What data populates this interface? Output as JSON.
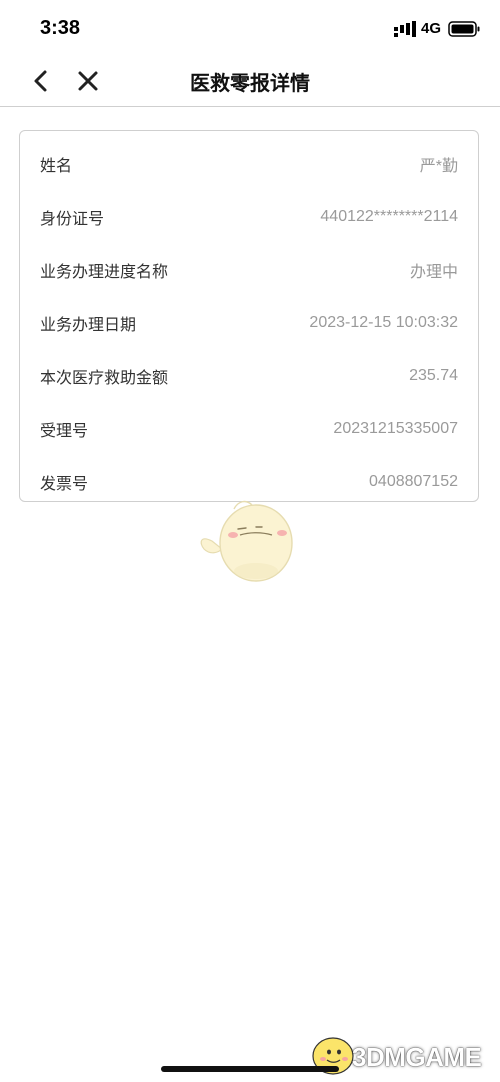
{
  "status_bar": {
    "time": "3:38",
    "network": "4G",
    "icons": [
      "signal-icon",
      "battery-icon"
    ]
  },
  "nav": {
    "title": "医救零报详情",
    "back_icon": "chevron-left-icon",
    "close_icon": "close-icon"
  },
  "details": [
    {
      "label": "姓名",
      "value": "严*勤"
    },
    {
      "label": "身份证号",
      "value": "440122********2114"
    },
    {
      "label": "业务办理进度名称",
      "value": "办理中"
    },
    {
      "label": "业务办理日期",
      "value": "2023-12-15 10:03:32"
    },
    {
      "label": "本次医疗救助金额",
      "value": "235.74"
    },
    {
      "label": "受理号",
      "value": "20231215335007"
    },
    {
      "label": "发票号",
      "value": "0408807152"
    }
  ],
  "watermark": {
    "text": "3DMGAME"
  },
  "colors": {
    "label": "#333333",
    "value": "#9a9a9a",
    "border": "#cfcfcf"
  }
}
